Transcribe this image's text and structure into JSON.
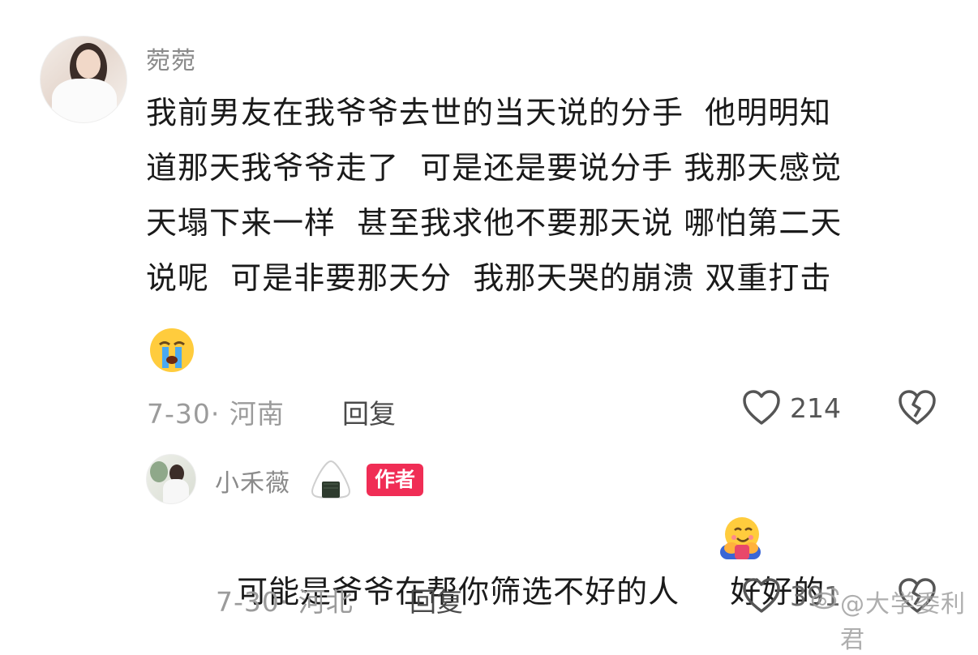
{
  "comments": [
    {
      "username": "菀菀",
      "text": "我前男友在我爷爷去世的当天说的分手  他明明知\n道那天我爷爷走了  可是还是要说分手 我那天感觉\n天塌下来一样  甚至我求他不要那天说 哪怕第二天\n说呢  可是非要那天分  我那天哭的崩溃 双重打击",
      "emoji": "loudly-crying-face",
      "date_location": "7-30· 河南",
      "reply_label": "回复",
      "likes": "214"
    }
  ],
  "reply": {
    "username": "小禾薇",
    "username_emoji": "rice-ball",
    "author_badge": "作者",
    "text_before": "可能是爷爷在帮你筛选不好的人",
    "emoji": "hugging-face",
    "text_after": "好好的",
    "date_location": "7-30· 河北",
    "reply_label": "回复",
    "likes": "391"
  },
  "watermark": "@大学委利君",
  "colors": {
    "accent": "#f02d55",
    "meta": "#9b9b9b",
    "username": "#8a8a8a"
  }
}
